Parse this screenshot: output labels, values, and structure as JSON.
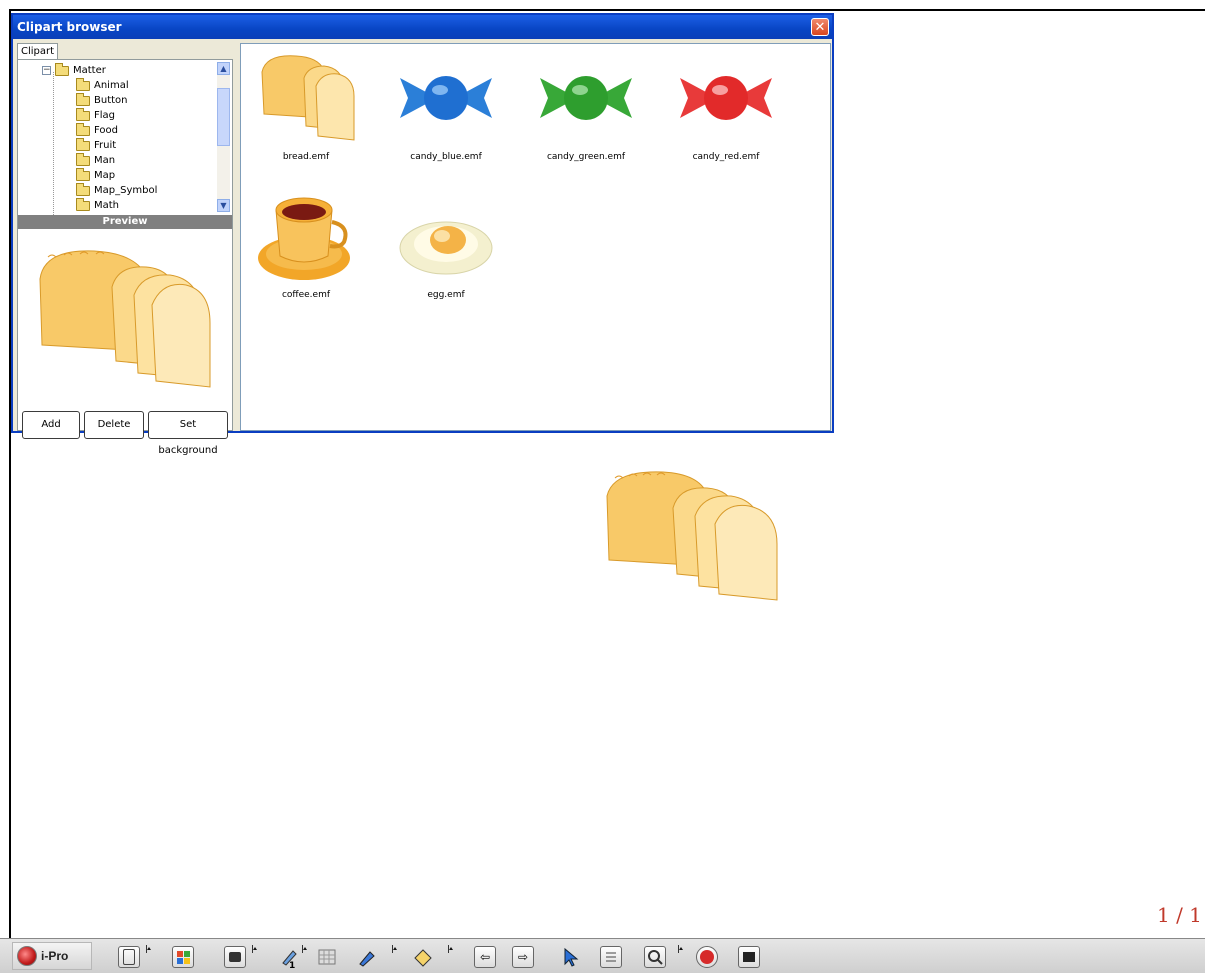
{
  "dialog": {
    "title": "Clipart browser",
    "close_label": "✕",
    "tab_label": "Clipart",
    "tree": {
      "root": "Matter",
      "items": [
        "Animal",
        "Button",
        "Flag",
        "Food",
        "Fruit",
        "Man",
        "Map",
        "Map_Symbol",
        "Math"
      ]
    },
    "preview_label": "Preview",
    "buttons": {
      "add": "Add",
      "delete": "Delete",
      "set_background": "Set background"
    },
    "files": [
      "bread.emf",
      "candy_blue.emf",
      "candy_green.emf",
      "candy_red.emf",
      "coffee.emf",
      "egg.emf"
    ]
  },
  "page_indicator": "1 / 1",
  "taskbar": {
    "app_label": "i-Pro",
    "pen_number": "1"
  },
  "colors": {
    "titlebar": "#0845c4",
    "candy_blue": "#1f6fd1",
    "candy_green": "#2e9e2e",
    "candy_red": "#e22a2a",
    "bread": "#f6c15a",
    "page_indicator": "#c0392b"
  }
}
